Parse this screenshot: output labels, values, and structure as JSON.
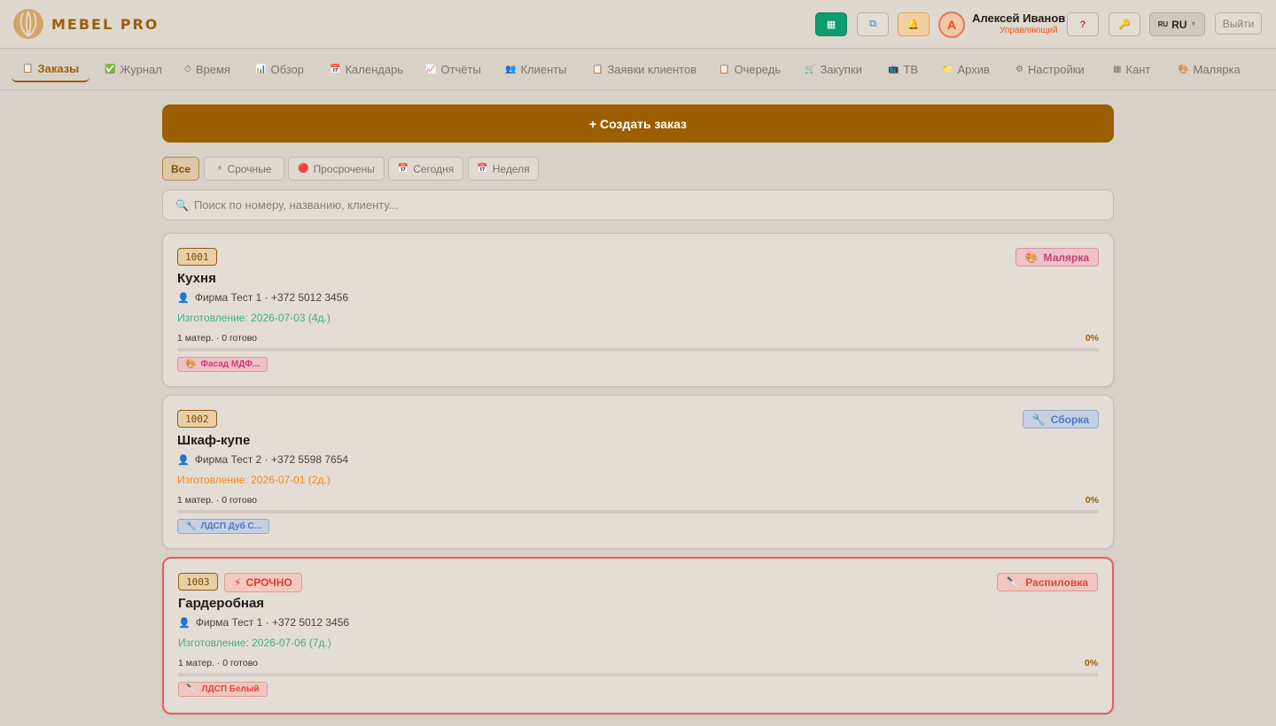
{
  "app": {
    "brand": "MEBEL PRO"
  },
  "header": {
    "user_name": "Алексей Иванов",
    "user_role": "Управляющий",
    "avatar_letter": "А",
    "help_label": "?",
    "lang_flag": "RU",
    "lang_label": "RU",
    "logout_label": "Выйти"
  },
  "nav": {
    "items": [
      {
        "label": "Заказы",
        "icon": "clipboard-icon",
        "glyph": "📋"
      },
      {
        "label": "Журнал",
        "icon": "check-icon",
        "glyph": "✅"
      },
      {
        "label": "Время",
        "icon": "timer-icon",
        "glyph": "⏱"
      },
      {
        "label": "Обзор",
        "icon": "bar-chart-icon",
        "glyph": "📊"
      },
      {
        "label": "Календарь",
        "icon": "calendar-icon",
        "glyph": "📅"
      },
      {
        "label": "Отчёты",
        "icon": "chart-up-icon",
        "glyph": "📈"
      },
      {
        "label": "Клиенты",
        "icon": "users-icon",
        "glyph": "👥"
      },
      {
        "label": "Заявки клиентов",
        "icon": "clipboard-icon",
        "glyph": "📋"
      },
      {
        "label": "Очередь",
        "icon": "clipboard-icon",
        "glyph": "📋"
      },
      {
        "label": "Закупки",
        "icon": "cart-icon",
        "glyph": "🛒"
      },
      {
        "label": "ТВ",
        "icon": "tv-icon",
        "glyph": "📺"
      },
      {
        "label": "Архив",
        "icon": "folder-icon",
        "glyph": "📁"
      },
      {
        "label": "Настройки",
        "icon": "gear-icon",
        "glyph": "⚙"
      },
      {
        "label": "Кант",
        "icon": "edge-icon",
        "glyph": "▦"
      },
      {
        "label": "Малярка",
        "icon": "paint-icon",
        "glyph": "🎨"
      }
    ]
  },
  "main": {
    "create_label": "+ Создать заказ",
    "filters": [
      {
        "label": "Все",
        "glyph": ""
      },
      {
        "label": "Срочные",
        "glyph": "⚡"
      },
      {
        "label": "Просрочены",
        "glyph": "🔴"
      },
      {
        "label": "Сегодня",
        "glyph": "📅"
      },
      {
        "label": "Неделя",
        "glyph": "📅"
      }
    ],
    "search_placeholder": "Поиск по номеру, названию, клиенту..."
  },
  "orders": [
    {
      "number": "1001",
      "title": "Кухня",
      "client": "Фирма Тест 1 · +372 5012 3456",
      "date": "Изготовление: 2026-07-03 (4д.)",
      "meta": "1 матер. · 0 готово",
      "percent": "0%",
      "progress": 0,
      "stage": "Малярка",
      "stage_glyph": "🎨",
      "material": "Фасад МДФ...",
      "material_glyph": "🎨"
    },
    {
      "number": "1002",
      "title": "Шкаф-купе",
      "client": "Фирма Тест 2 · +372 5598 7654",
      "date": "Изготовление: 2026-07-01 (2д.)",
      "meta": "1 матер. · 0 готово",
      "percent": "0%",
      "progress": 0,
      "stage": "Сборка",
      "stage_glyph": "🔧",
      "material": "ЛДСП Дуб С...",
      "material_glyph": "🔧"
    },
    {
      "number": "1003",
      "urgent": "СРОЧНО",
      "title": "Гардеробная",
      "client": "Фирма Тест 1 · +372 5012 3456",
      "date": "Изготовление: 2026-07-06 (7д.)",
      "meta": "1 матер. · 0 готово",
      "percent": "0%",
      "progress": 0,
      "stage": "Распиловка",
      "stage_glyph": "🔪",
      "material": "ЛДСП Белый",
      "material_glyph": "🔪"
    }
  ]
}
